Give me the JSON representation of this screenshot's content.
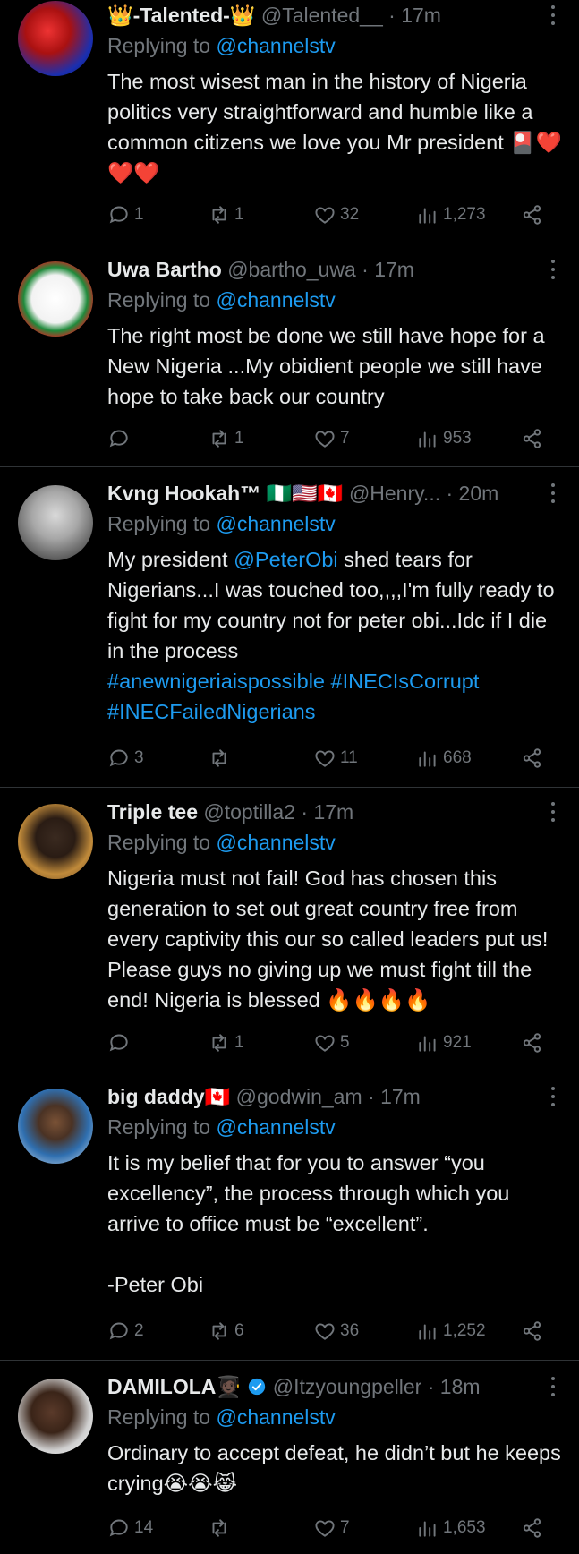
{
  "reply_prefix": "Replying to ",
  "tweets": [
    {
      "name": "👑-Talented-👑",
      "handle": "@Talented__",
      "time": "· 17m",
      "replying_to": "@channelstv",
      "text": "The most wisest man in the history of Nigeria politics very straightforward and humble like a common citizens we love you Mr president 🎴❤️❤️❤️",
      "replies": "1",
      "retweets": "1",
      "likes": "32",
      "views": "1,273"
    },
    {
      "name": "Uwa Bartho",
      "handle": "@bartho_uwa",
      "time": "· 17m",
      "replying_to": "@channelstv",
      "text": "The right most be done we still have hope for a New Nigeria ...My obidient people we still have hope to take back our country",
      "replies": "",
      "retweets": "1",
      "likes": "7",
      "views": "953"
    },
    {
      "name": "Kvng Hookah™ 🇳🇬🇺🇸🇨🇦",
      "handle": "@Henry...",
      "time": "· 20m",
      "replying_to": "@channelstv",
      "text_parts": [
        {
          "t": "My president ",
          "link": false
        },
        {
          "t": "@PeterObi",
          "link": true
        },
        {
          "t": " shed tears for Nigerians...I was touched too,,,,I'm fully ready to fight for my country not for peter obi...Idc if I die in the process\n",
          "link": false
        },
        {
          "t": "#anewnigeriaispossible",
          "link": true
        },
        {
          "t": " ",
          "link": false
        },
        {
          "t": "#INECIsCorrupt",
          "link": true
        },
        {
          "t": "\n",
          "link": false
        },
        {
          "t": "#INECFailedNigerians",
          "link": true
        }
      ],
      "replies": "3",
      "retweets": "",
      "likes": "11",
      "views": "668"
    },
    {
      "name": "Triple tee",
      "handle": "@toptilla2",
      "time": "· 17m",
      "replying_to": "@channelstv",
      "text": "Nigeria must not fail! God has chosen this generation to set out great country free from every captivity this our so called leaders put us! Please guys no giving up we must fight till the end! Nigeria is blessed 🔥🔥🔥🔥",
      "replies": "",
      "retweets": "1",
      "likes": "5",
      "views": "921"
    },
    {
      "name": "big daddy🇨🇦",
      "handle": "@godwin_am",
      "time": "· 17m",
      "replying_to": "@channelstv",
      "text": "It is my belief that for you to answer “you excellency”, the process through which you arrive to office must be “excellent”.\n\n-Peter Obi",
      "replies": "2",
      "retweets": "6",
      "likes": "36",
      "views": "1,252"
    },
    {
      "name": "DAMILOLA🧑🏿‍🎓",
      "handle": "@Itzyoungpeller",
      "time": "· 18m",
      "replying_to": "@channelstv",
      "text": "Ordinary to accept defeat, he didn’t but he keeps crying😭😭😹",
      "replies": "14",
      "retweets": "",
      "likes": "7",
      "views": "1,653"
    }
  ],
  "colors": {
    "background": "#000000",
    "text": "#e7e9ea",
    "muted": "#71767b",
    "link": "#1d9bf0",
    "divider": "#2f3336",
    "verified": "#1d9bf0"
  }
}
